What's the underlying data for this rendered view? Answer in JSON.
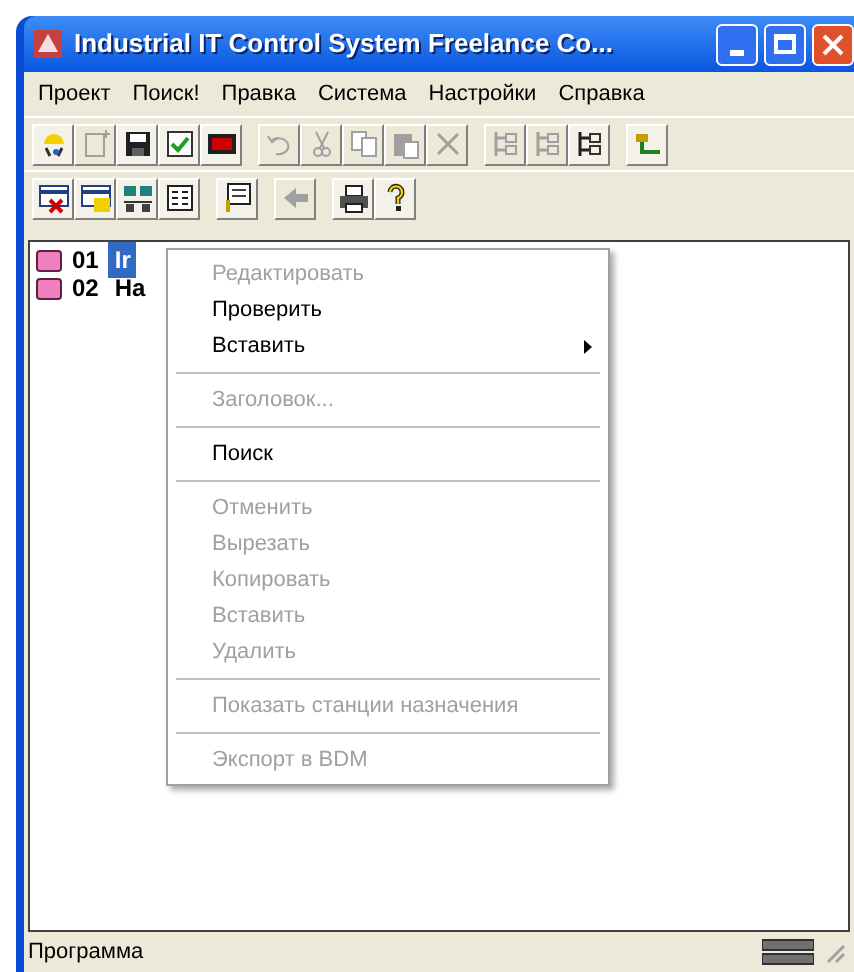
{
  "window": {
    "title": "Industrial IT Control System Freelance Co..."
  },
  "menu_bar": [
    "Проект",
    "Поиск!",
    "Правка",
    "Система",
    "Настройки",
    "Справка"
  ],
  "toolbar_rows": [
    [
      {
        "kind": "wizard",
        "disabled": false
      },
      {
        "kind": "new",
        "disabled": true
      },
      {
        "kind": "save",
        "disabled": false
      },
      {
        "kind": "check",
        "disabled": false
      },
      {
        "kind": "red",
        "disabled": false
      },
      {
        "kind": "gap"
      },
      {
        "kind": "undo",
        "disabled": true
      },
      {
        "kind": "cut",
        "disabled": true
      },
      {
        "kind": "copy",
        "disabled": true
      },
      {
        "kind": "paste",
        "disabled": true
      },
      {
        "kind": "delete",
        "disabled": true
      },
      {
        "kind": "gap"
      },
      {
        "kind": "tree",
        "disabled": true
      },
      {
        "kind": "tree",
        "disabled": true
      },
      {
        "kind": "tree",
        "disabled": false
      },
      {
        "kind": "gap"
      },
      {
        "kind": "network",
        "disabled": false
      }
    ],
    [
      {
        "kind": "table-x",
        "disabled": false
      },
      {
        "kind": "table-pic",
        "disabled": false
      },
      {
        "kind": "station",
        "disabled": false
      },
      {
        "kind": "list",
        "disabled": false
      },
      {
        "kind": "gap"
      },
      {
        "kind": "note",
        "disabled": false
      },
      {
        "kind": "gap"
      },
      {
        "kind": "back",
        "disabled": true
      },
      {
        "kind": "gap"
      },
      {
        "kind": "print",
        "disabled": false
      },
      {
        "kind": "help",
        "disabled": false
      }
    ]
  ],
  "tree": [
    {
      "number": "01",
      "label": "Ir",
      "selected": true
    },
    {
      "number": "02",
      "label": "Ha",
      "selected": false
    }
  ],
  "context_menu": [
    {
      "kind": "item",
      "label": "Редактировать",
      "disabled": true,
      "submenu": false
    },
    {
      "kind": "item",
      "label": "Проверить",
      "disabled": false,
      "submenu": false
    },
    {
      "kind": "item",
      "label": "Вставить",
      "disabled": false,
      "submenu": true
    },
    {
      "kind": "separator"
    },
    {
      "kind": "item",
      "label": "Заголовок...",
      "disabled": true,
      "submenu": false
    },
    {
      "kind": "separator"
    },
    {
      "kind": "item",
      "label": "Поиск",
      "disabled": false,
      "submenu": false
    },
    {
      "kind": "separator"
    },
    {
      "kind": "item",
      "label": "Отменить",
      "disabled": true,
      "submenu": false
    },
    {
      "kind": "item",
      "label": "Вырезать",
      "disabled": true,
      "submenu": false
    },
    {
      "kind": "item",
      "label": "Копировать",
      "disabled": true,
      "submenu": false
    },
    {
      "kind": "item",
      "label": "Вставить",
      "disabled": true,
      "submenu": false
    },
    {
      "kind": "item",
      "label": "Удалить",
      "disabled": true,
      "submenu": false
    },
    {
      "kind": "separator"
    },
    {
      "kind": "item",
      "label": "Показать станции назначения",
      "disabled": true,
      "submenu": false
    },
    {
      "kind": "separator"
    },
    {
      "kind": "item",
      "label": "Экспорт в BDM",
      "disabled": true,
      "submenu": false
    }
  ],
  "status_bar": {
    "text": "Программа"
  }
}
